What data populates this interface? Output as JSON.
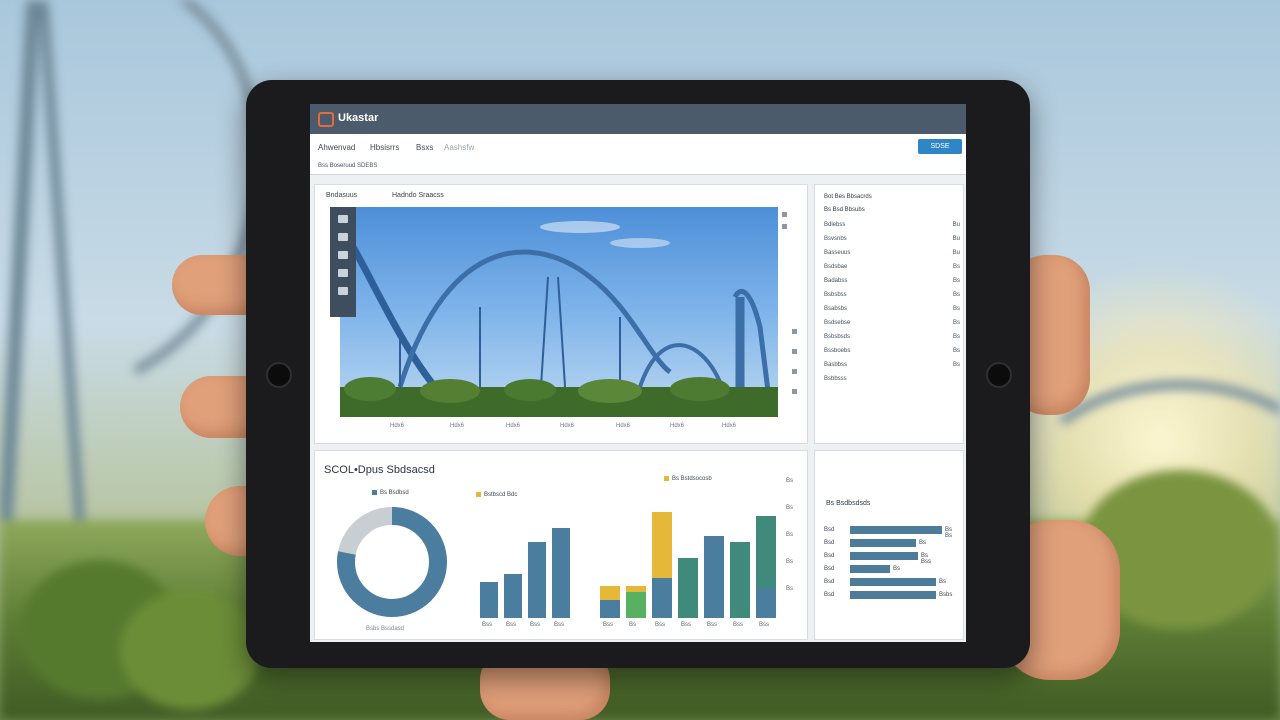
{
  "app": {
    "title": "Ukastar",
    "nav": [
      "Ahwenvad",
      "Hbsisrrs",
      "Bsxs",
      "Aashsfw"
    ],
    "subnav": [
      "Bss Boseruud SDEBS"
    ],
    "nav_button": "SDSE"
  },
  "media_panel": {
    "label_left": "Bndasuus",
    "label_right": "Hadndo Sraacss",
    "x_ticks": [
      "Hdx6",
      "Hdx6",
      "Hdx6",
      "Hdx6",
      "Hdx6",
      "Hdx6",
      "Hdx6"
    ]
  },
  "list_panel": {
    "heading_1": "Bot  Bes  Bbsacrds",
    "heading_2": "Bs Bsd  Bbsubs",
    "rows": [
      {
        "label": "Bdlebss",
        "value": "Bu"
      },
      {
        "label": "Bsvsnbs",
        "value": "Bu"
      },
      {
        "label": "Basseuus",
        "value": "Bu"
      },
      {
        "label": "Bsdsbae",
        "value": "Bs"
      },
      {
        "label": "Badabss",
        "value": "Bs"
      },
      {
        "label": "Bsbsbss",
        "value": "Bs"
      },
      {
        "label": "Bsabsbs",
        "value": "Bs"
      },
      {
        "label": "Bsdsebse",
        "value": "Bs"
      },
      {
        "label": "Bsbsbsds",
        "value": "Bs"
      },
      {
        "label": "Bssboebs",
        "value": "Bs"
      },
      {
        "label": "Basbbss",
        "value": "Bs"
      },
      {
        "label": "Bsbbsss",
        "value": ""
      }
    ]
  },
  "bottom_section": {
    "title": "SCOL•Dpus Sbdsacsd",
    "donut_label": "Bs Bsdbsd",
    "bars_label": "Bstbscd Bdc",
    "stacked_label": "Bs Bstdsocosb",
    "donut_caption": "Bsbs Bssdasd",
    "bar_ticks": [
      "Bss",
      "Bss",
      "Bss",
      "Bss"
    ],
    "stacked_ticks": [
      "Bss",
      "Bs",
      "Bss",
      "Bss",
      "Bss",
      "Bss",
      "Bss",
      "Bss"
    ],
    "y_ticks": [
      "Bs",
      "Bs",
      "Bs",
      "Bs",
      "Bs"
    ]
  },
  "hbar_panel": {
    "heading": "Bs Bsdbsdsds",
    "rows": [
      {
        "label": "Bsd",
        "value": "Bs Bs"
      },
      {
        "label": "Bsd",
        "value": "Bs"
      },
      {
        "label": "Bsd",
        "value": "Bs Bss"
      },
      {
        "label": "Bsd",
        "value": "Bs"
      },
      {
        "label": "Bsd",
        "value": "Bs"
      },
      {
        "label": "Bsd",
        "value": "Bsbs"
      }
    ]
  },
  "colors": {
    "primary_blue": "#4a7d9e",
    "accent_yellow": "#e6b83a",
    "accent_green": "#58b061",
    "teal": "#3f8a7a",
    "gray": "#c8cdd2"
  }
}
